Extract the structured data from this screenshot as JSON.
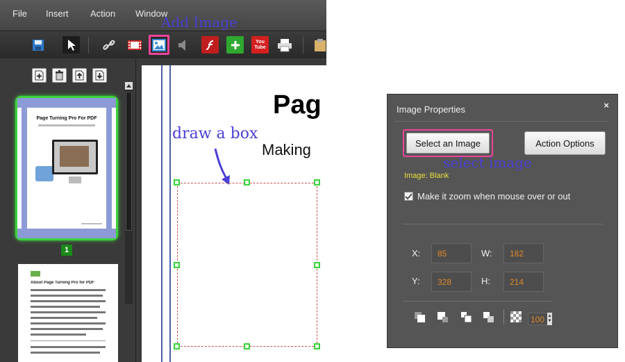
{
  "app": {
    "menu": [
      "File",
      "Insert",
      "Action",
      "Window"
    ]
  },
  "toolbar": {
    "items": [
      {
        "name": "save-icon"
      },
      {
        "name": "select-pointer-icon"
      },
      {
        "name": "link-icon"
      },
      {
        "name": "video-icon"
      },
      {
        "name": "image-icon",
        "highlighted": true
      },
      {
        "name": "sound-icon"
      },
      {
        "name": "flash-icon"
      },
      {
        "name": "add-green-icon"
      },
      {
        "name": "youtube-icon"
      },
      {
        "name": "printer-icon"
      },
      {
        "name": "clipboard-icon"
      }
    ],
    "youtube_text": "You Tube"
  },
  "annotations": {
    "add_image": "Add Image",
    "draw_a_box": "draw a box",
    "select_image": "select image"
  },
  "thumbnails": {
    "page1_title": "Page Turning Pro For PDF",
    "page1_number": "1",
    "page2_heading": "About Page Turning Pro for PDF"
  },
  "canvas": {
    "heading": "Pag",
    "subheading": "Making"
  },
  "dialog": {
    "title": "Image Properties",
    "close": "×",
    "select_image_button": "Select an Image",
    "action_options_button": "Action Options",
    "image_status": "Image: Blank",
    "zoom_checkbox_label": "Make it zoom when mouse over or out",
    "zoom_checked": true,
    "x_label": "X:",
    "x_value": "85",
    "w_label": "W:",
    "w_value": "182",
    "y_label": "Y:",
    "y_value": "328",
    "h_label": "H:",
    "h_value": "214",
    "opacity_value": "100"
  },
  "colors": {
    "annotation": "#4a3fd6",
    "highlight": "#f0449a",
    "selection_green": "#3cd23c",
    "value_orange": "#e0892a",
    "status_yellow": "#e6e13a"
  }
}
